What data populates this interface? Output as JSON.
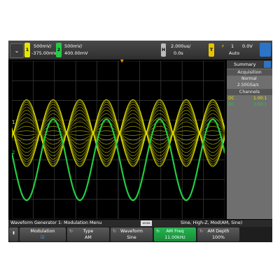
{
  "topbar": {
    "menu_glyph": "⌄",
    "ch1": {
      "number": "1",
      "scale": "500mV/",
      "offset": "-375.00mV",
      "color": "#e6e600"
    },
    "ch2": {
      "number": "2",
      "scale": "500mV/",
      "offset": "400.00mV",
      "color": "#22cc44"
    },
    "horizontal": {
      "badge": "H",
      "timebase": "2.000us/",
      "delay": "0.0s"
    },
    "trigger": {
      "badge": "T",
      "icon": "⚡",
      "source": "1",
      "level": "0.0V",
      "mode": "Auto"
    }
  },
  "plot": {
    "ch1_marker": "1",
    "ch2_marker": "2",
    "trigger_marker": "▼"
  },
  "side": {
    "summary_label": "Summary",
    "acquisition_header": "Acquisition",
    "acq_mode": "Normal",
    "sample_rate": "2.50GSa/s",
    "channels_header": "Channels",
    "ch_rows": [
      {
        "coupling": "DC",
        "probe": "1.00:1",
        "color": "#e6e600"
      },
      {
        "coupling": "DC",
        "probe": "1.00:1",
        "color": "#22cc44"
      }
    ]
  },
  "status": {
    "menu_title": "Waveform Generator 1: Modulation Menu",
    "badge": "WGEN",
    "wgen_status": "Sine, High-Z, Mod(AM, Sine)"
  },
  "softkeys": [
    {
      "label": "Modulation",
      "value": "☑",
      "highlight": false
    },
    {
      "label": "Type",
      "value": "AM",
      "highlight": false
    },
    {
      "label": "Waveform",
      "value": "Sine",
      "highlight": false
    },
    {
      "label": "AM Freq",
      "value": "11.00kHz",
      "highlight": true
    },
    {
      "label": "AM Depth",
      "value": "100%",
      "highlight": false
    }
  ],
  "back_glyph": "⬆",
  "colors": {
    "ch1": "#e6e600",
    "ch2": "#22cc44",
    "grid": "#3c3c3c",
    "highlight": "#1fa046"
  },
  "waveform": {
    "ch1": {
      "type": "AM sine envelope",
      "amplitude_divs": 1.7,
      "center_divs_from_top": 3.65,
      "period_us": 5.0,
      "offset_phase_deg": 0
    },
    "ch2": {
      "type": "sine",
      "amplitude_divs": 2.05,
      "center_divs_from_top": 5.0,
      "period_us": 5.0
    }
  }
}
